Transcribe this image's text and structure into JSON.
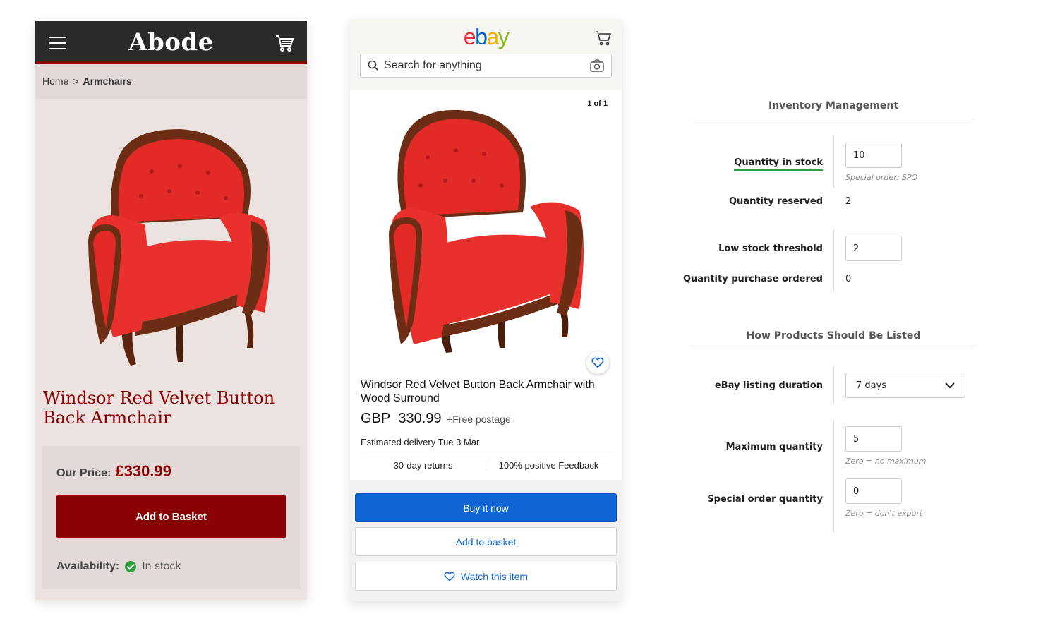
{
  "abode": {
    "brand": "Abode",
    "breadcrumb": {
      "home": "Home",
      "separator": ">",
      "current": "Armchairs"
    },
    "product_title": "Windsor Red Velvet Button Back Armchair",
    "price_label": "Our Price:",
    "price": "£330.99",
    "add_button": "Add to Basket",
    "availability_label": "Availability:",
    "availability_value": "In stock",
    "colors": {
      "accent": "#8b0000",
      "header": "#2a2a2a",
      "background": "#ece3e0",
      "in_stock": "#2e9e3e"
    }
  },
  "ebay": {
    "logo": {
      "e": "e",
      "b": "b",
      "a": "a",
      "y": "y"
    },
    "search_placeholder": "Search for anything",
    "image_counter": "1 of 1",
    "product_title": "Windsor Red Velvet Button Back Armchair with Wood Surround",
    "currency": "GBP",
    "price": "330.99",
    "postage": "+Free postage",
    "delivery_label": "Estimated delivery",
    "delivery_date": "Tue 3 Mar",
    "returns": "30-day returns",
    "feedback": "100% positive Feedback",
    "buy_button": "Buy it now",
    "basket_button": "Add to basket",
    "watch_button": "Watch this item",
    "colors": {
      "primary": "#1065d6"
    }
  },
  "inventory": {
    "section1_title": "Inventory Management",
    "quantity_in_stock": {
      "label": "Quantity in stock",
      "value": "10",
      "hint": "Special order: SPO"
    },
    "quantity_reserved": {
      "label": "Quantity reserved",
      "value": "2"
    },
    "low_stock_threshold": {
      "label": "Low stock threshold",
      "value": "2"
    },
    "quantity_purchase_ordered": {
      "label": "Quantity purchase ordered",
      "value": "0"
    },
    "section2_title": "How Products Should Be Listed",
    "listing_duration": {
      "label": "eBay listing duration",
      "value": "7 days"
    },
    "maximum_quantity": {
      "label": "Maximum quantity",
      "value": "5",
      "hint": "Zero = no maximum"
    },
    "special_order_quantity": {
      "label": "Special order quantity",
      "value": "0",
      "hint": "Zero = don't export"
    }
  }
}
